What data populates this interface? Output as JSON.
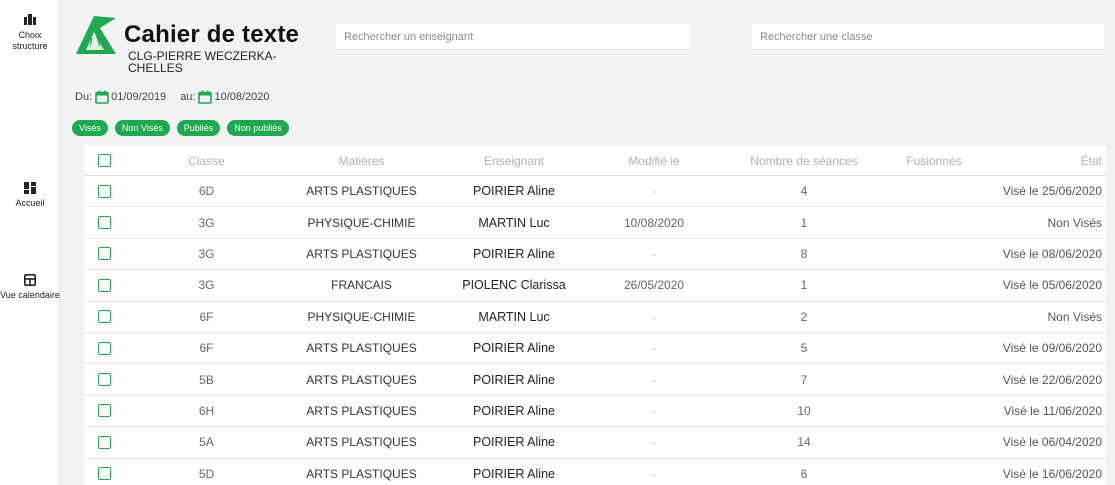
{
  "sidebar": {
    "structure_label": "Choix structure",
    "home_label": "Accueil",
    "calendar_label": "Vue calendaire"
  },
  "header": {
    "title": "Cahier de texte",
    "school": "CLG-PIERRE WECZERKA-CHELLES",
    "teacher_search_placeholder": "Rechercher un enseignant",
    "class_search_placeholder": "Rechercher une classe"
  },
  "dates": {
    "from_label": "Du:",
    "from_value": "01/09/2019",
    "to_label": "au:",
    "to_value": "10/08/2020"
  },
  "filters": [
    "Visés",
    "Non Visés",
    "Publiés",
    "Non publiés"
  ],
  "colors": {
    "accent": "#1fa84f"
  },
  "table": {
    "columns": [
      "Classe",
      "Matières",
      "Enseignant",
      "Modifié le",
      "Nombre de séances",
      "Fusionnés",
      "État"
    ],
    "rows": [
      {
        "classe": "6D",
        "matiere": "ARTS PLASTIQUES",
        "enseignant": "POIRIER Aline",
        "modifie": "-",
        "seances": "4",
        "fusionnes": "",
        "etat": "Visé le 25/06/2020"
      },
      {
        "classe": "3G",
        "matiere": "PHYSIQUE-CHIMIE",
        "enseignant": "MARTIN Luc",
        "modifie": "10/08/2020",
        "seances": "1",
        "fusionnes": "",
        "etat": "Non Visés"
      },
      {
        "classe": "3G",
        "matiere": "ARTS PLASTIQUES",
        "enseignant": "POIRIER Aline",
        "modifie": "-",
        "seances": "8",
        "fusionnes": "",
        "etat": "Visé le 08/06/2020"
      },
      {
        "classe": "3G",
        "matiere": "FRANCAIS",
        "enseignant": "PIOLENC Clarissa",
        "modifie": "26/05/2020",
        "seances": "1",
        "fusionnes": "",
        "etat": "Visé le 05/06/2020"
      },
      {
        "classe": "6F",
        "matiere": "PHYSIQUE-CHIMIE",
        "enseignant": "MARTIN Luc",
        "modifie": "-",
        "seances": "2",
        "fusionnes": "",
        "etat": "Non Visés"
      },
      {
        "classe": "6F",
        "matiere": "ARTS PLASTIQUES",
        "enseignant": "POIRIER Aline",
        "modifie": "-",
        "seances": "5",
        "fusionnes": "",
        "etat": "Visé le 09/06/2020"
      },
      {
        "classe": "5B",
        "matiere": "ARTS PLASTIQUES",
        "enseignant": "POIRIER Aline",
        "modifie": "-",
        "seances": "7",
        "fusionnes": "",
        "etat": "Visé le 22/06/2020"
      },
      {
        "classe": "6H",
        "matiere": "ARTS PLASTIQUES",
        "enseignant": "POIRIER Aline",
        "modifie": "-",
        "seances": "10",
        "fusionnes": "",
        "etat": "Visé le 11/06/2020"
      },
      {
        "classe": "5A",
        "matiere": "ARTS PLASTIQUES",
        "enseignant": "POIRIER Aline",
        "modifie": "-",
        "seances": "14",
        "fusionnes": "",
        "etat": "Visé le 06/04/2020"
      },
      {
        "classe": "5D",
        "matiere": "ARTS PLASTIQUES",
        "enseignant": "POIRIER Aline",
        "modifie": "-",
        "seances": "6",
        "fusionnes": "",
        "etat": "Visé le 16/06/2020"
      }
    ]
  }
}
